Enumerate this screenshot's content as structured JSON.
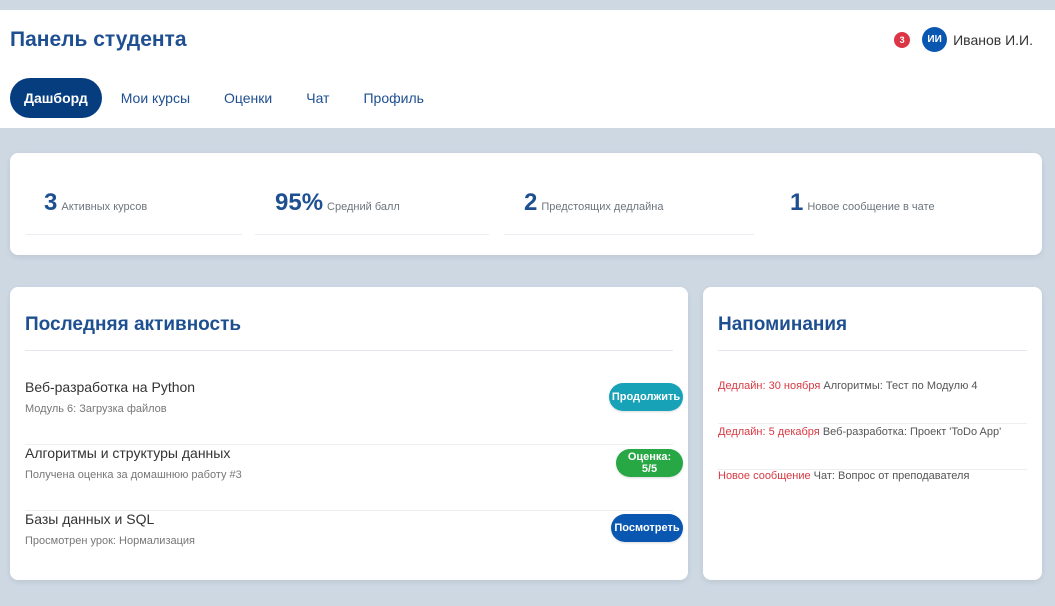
{
  "header": {
    "title": "Панель студента",
    "notifications_count": "3",
    "avatar_initials": "ИИ",
    "user_name": "Иванов И.И."
  },
  "nav": {
    "items": [
      "Дашборд",
      "Мои курсы",
      "Оценки",
      "Чат",
      "Профиль"
    ],
    "active": "Дашборд"
  },
  "stats": [
    {
      "value": "3",
      "label": "Активных курсов"
    },
    {
      "value": "95%",
      "label": "Средний балл"
    },
    {
      "value": "2",
      "label": "Предстоящих дедлайна"
    },
    {
      "value": "1",
      "label": "Новое сообщение в чате"
    }
  ],
  "activity": {
    "title": "Последняя активность",
    "items": [
      {
        "title": "Веб-разработка на Python",
        "subtitle": "Модуль 6: Загрузка файлов",
        "button": "Продолжить",
        "button_color": "#17a2b8"
      },
      {
        "title": "Алгоритмы и структуры данных",
        "subtitle": "Получена оценка за домашнюю работу #3",
        "button": "Оценка: 5/5",
        "button_color": "#28a745"
      },
      {
        "title": "Базы данных и SQL",
        "subtitle": "Просмотрен урок: Нормализация",
        "button": "Посмотреть",
        "button_color": "#0a57b2"
      }
    ]
  },
  "reminders": {
    "title": "Напоминания",
    "items": [
      {
        "tag": "Дедлайн: 30 ноября",
        "text": "Алгоритмы: Тест по Модулю 4"
      },
      {
        "tag": "Дедлайн: 5 декабря",
        "text": "Веб-разработка: Проект 'ToDo App'"
      },
      {
        "tag": "Новое сообщение",
        "text": "Чат: Вопрос от преподавателя"
      }
    ]
  },
  "colors": {
    "primary": "#1e4f91",
    "nav_active": "#063d7f",
    "danger": "#dc3545",
    "background": "#cdd8e3"
  }
}
